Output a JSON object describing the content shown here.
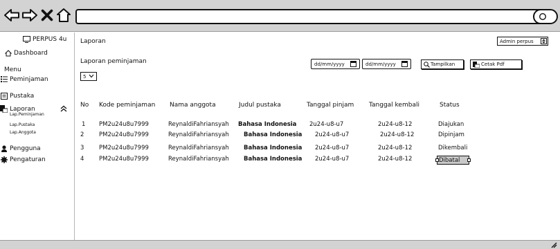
{
  "browser": {
    "nav_icons": [
      "back-arrow-icon",
      "forward-arrow-icon",
      "close-icon",
      "home-icon"
    ],
    "search_icon": "search-icon"
  },
  "sidebar": {
    "logo_label": "PERPUS 4u",
    "dashboard_label": "Dashboard",
    "menu_heading": "Menu",
    "items": [
      {
        "label": "Peminjaman",
        "icon": "list-icon"
      },
      {
        "label": "Pustaka",
        "icon": "book-icon"
      },
      {
        "label": "Laporan",
        "icon": "report-icon"
      }
    ],
    "sub_items": [
      "Lap.Peminjaman",
      "Lap.Pustaka",
      "Lap.Anggota"
    ],
    "bottom_items": [
      {
        "label": "Pengguna",
        "icon": "user-icon"
      },
      {
        "label": "Pengaturan",
        "icon": "gear-icon"
      }
    ]
  },
  "header": {
    "title": "Laporan",
    "user_select": "Admin perpus"
  },
  "report": {
    "subtitle": "Laporan peminjaman",
    "page_size": "5",
    "date_from_placeholder": "dd/mm/yyyy",
    "date_to_placeholder": "dd/mm/yyyy",
    "show_button": "Tampilkan",
    "print_button": "Cetak Pdf"
  },
  "table": {
    "headers": [
      "No",
      "Kode peminjaman",
      "Nama anggota",
      "Judul pustaka",
      "Tanggal pinjam",
      "Tanggal kembali",
      "Status"
    ],
    "rows": [
      [
        "1",
        "PM2u24u8u7999",
        "ReynaldiFahriansyah",
        "Bahasa Indonesia",
        "2u24-u8-u7",
        "2u24-u8-12",
        "Diajukan"
      ],
      [
        "2",
        "PM2u24u8u7999",
        "ReynaldiFahriansyah",
        "Bahasa Indonesia",
        "2u24-u8-u7",
        "2u24-u8-12",
        "Dipinjam"
      ],
      [
        "3",
        "PM2u24u8u7999",
        "ReynaldiFahriansyah",
        "Bahasa Indonesia",
        "2u24-u8-u7",
        "2u24-u8-12",
        "Dikembali"
      ],
      [
        "4",
        "PM2u24u8u7999",
        "ReynaldiFahriansyah",
        "Bahasa Indonesia",
        "2u24-u8-u7",
        "2u24-u8-12",
        "Dibatal"
      ]
    ]
  }
}
